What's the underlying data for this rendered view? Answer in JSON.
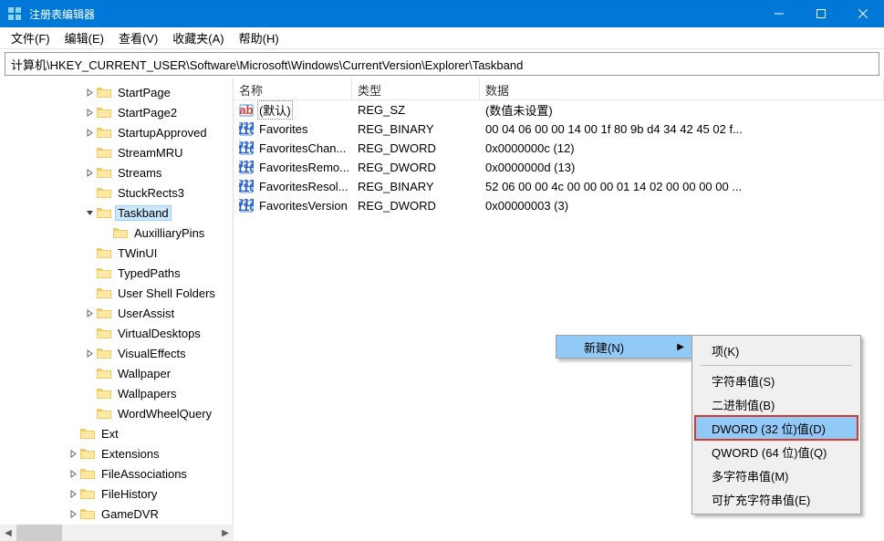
{
  "window": {
    "title": "注册表编辑器"
  },
  "menu": {
    "file": "文件(F)",
    "edit": "编辑(E)",
    "view": "查看(V)",
    "favorites": "收藏夹(A)",
    "help": "帮助(H)"
  },
  "address": "计算机\\HKEY_CURRENT_USER\\Software\\Microsoft\\Windows\\CurrentVersion\\Explorer\\Taskband",
  "tree": {
    "items": [
      {
        "depth": 5,
        "exp": ">",
        "label": "StartPage"
      },
      {
        "depth": 5,
        "exp": ">",
        "label": "StartPage2"
      },
      {
        "depth": 5,
        "exp": ">",
        "label": "StartupApproved"
      },
      {
        "depth": 5,
        "exp": "",
        "label": "StreamMRU"
      },
      {
        "depth": 5,
        "exp": ">",
        "label": "Streams"
      },
      {
        "depth": 5,
        "exp": "",
        "label": "StuckRects3"
      },
      {
        "depth": 5,
        "exp": "v",
        "label": "Taskband",
        "selected": true
      },
      {
        "depth": 6,
        "exp": "",
        "label": "AuxilliaryPins"
      },
      {
        "depth": 5,
        "exp": "",
        "label": "TWinUI"
      },
      {
        "depth": 5,
        "exp": "",
        "label": "TypedPaths"
      },
      {
        "depth": 5,
        "exp": "",
        "label": "User Shell Folders"
      },
      {
        "depth": 5,
        "exp": ">",
        "label": "UserAssist"
      },
      {
        "depth": 5,
        "exp": "",
        "label": "VirtualDesktops"
      },
      {
        "depth": 5,
        "exp": ">",
        "label": "VisualEffects"
      },
      {
        "depth": 5,
        "exp": "",
        "label": "Wallpaper"
      },
      {
        "depth": 5,
        "exp": "",
        "label": "Wallpapers"
      },
      {
        "depth": 5,
        "exp": "",
        "label": "WordWheelQuery"
      },
      {
        "depth": 4,
        "exp": "",
        "label": "Ext"
      },
      {
        "depth": 4,
        "exp": ">",
        "label": "Extensions"
      },
      {
        "depth": 4,
        "exp": ">",
        "label": "FileAssociations"
      },
      {
        "depth": 4,
        "exp": ">",
        "label": "FileHistory"
      },
      {
        "depth": 4,
        "exp": ">",
        "label": "GameDVR"
      }
    ]
  },
  "columns": {
    "name": "名称",
    "type": "类型",
    "data": "数据"
  },
  "values": [
    {
      "icon": "sz",
      "name": "(默认)",
      "focused": true,
      "type": "REG_SZ",
      "data": "(数值未设置)"
    },
    {
      "icon": "bin",
      "name": "Favorites",
      "type": "REG_BINARY",
      "data": "00 04 06 00 00 14 00 1f 80 9b d4 34 42 45 02 f..."
    },
    {
      "icon": "bin",
      "name": "FavoritesChan...",
      "type": "REG_DWORD",
      "data": "0x0000000c (12)"
    },
    {
      "icon": "bin",
      "name": "FavoritesRemo...",
      "type": "REG_DWORD",
      "data": "0x0000000d (13)"
    },
    {
      "icon": "bin",
      "name": "FavoritesResol...",
      "type": "REG_BINARY",
      "data": "52 06 00 00 4c 00 00 00 01 14 02 00 00 00 00 ..."
    },
    {
      "icon": "bin",
      "name": "FavoritesVersion",
      "type": "REG_DWORD",
      "data": "0x00000003 (3)"
    }
  ],
  "context": {
    "new": "新建(N)",
    "submenu": {
      "key": "项(K)",
      "string": "字符串值(S)",
      "binary": "二进制值(B)",
      "dword": "DWORD (32 位)值(D)",
      "qword": "QWORD (64 位)值(Q)",
      "multi": "多字符串值(M)",
      "expand": "可扩充字符串值(E)"
    }
  }
}
